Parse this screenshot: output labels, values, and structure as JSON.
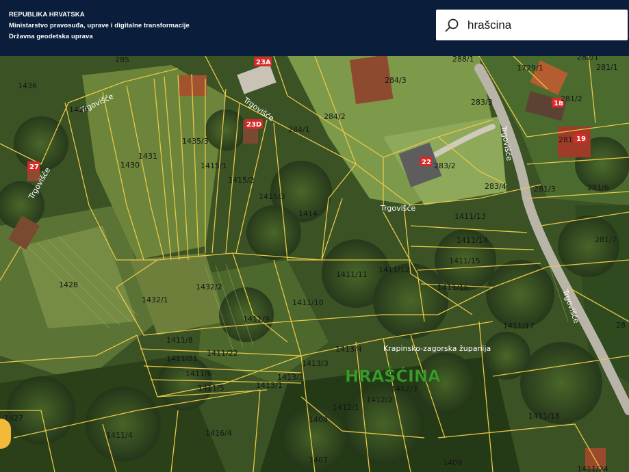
{
  "header": {
    "line1": "REPUBLIKA HRVATSKA",
    "line2": "Ministarstvo pravosuđa, uprave i digitalne transformacije",
    "line3": "Državna geodetska uprava"
  },
  "search": {
    "value": "hrašcina",
    "icon": "search-icon"
  },
  "map": {
    "place_name": "HRAŠĆINA",
    "county_label": "Krapinsko-zagorska županija",
    "roads": {
      "trgoviste_nw": "Trgovišće",
      "trgoviste_top": "Trgovišće",
      "trgoviste_mid": "Trgovišće",
      "trgoviste_right": "Trgovišće",
      "trgoviste_right2": "Trgovišće",
      "trgoviste_left": "Trgovišće"
    },
    "house_numbers": {
      "h23a": "23A",
      "h23d": "23D",
      "h22": "22",
      "h18": "18",
      "h19": "19",
      "h27": "27"
    },
    "parcels": {
      "p1436": "1436",
      "p285": "285",
      "p1429": "1429",
      "p1431": "1431",
      "p1430": "1430",
      "p1435_3": "1435/3",
      "p1415_1": "1415/1",
      "p1415_2": "1415/2",
      "p1415_3": "1415/3",
      "p1414": "1414",
      "p284_1": "284/1",
      "p284_2": "284/2",
      "p284_3": "284/3",
      "p288_1": "288/1",
      "p1729_1": "1729/1",
      "p282_1": "282/1",
      "p281_1": "281/1",
      "p281_2": "281/2",
      "p283_3": "283/3",
      "p281": "281",
      "p283_2": "283/2",
      "p283_4": "283/4",
      "p281_3": "281/3",
      "p281_6": "281/6",
      "p281_7": "281/7",
      "p1411_13": "1411/13",
      "p1411_14": "1411/14",
      "p1411_15": "1411/15",
      "p1411_16": "1411/16",
      "p1411_11": "1411/11",
      "p1411_12": "1411/12",
      "p1428": "1428",
      "p1432_2": "1432/2",
      "p1432_1": "1432/1",
      "p1411_10": "1411/10",
      "p1411_9": "1411/9",
      "p1411_17": "1411/17",
      "p1411_8": "1411/8",
      "p1411_21": "1411/21",
      "p1411_22": "1411/22",
      "p1413_4": "1413/4",
      "p1413_3": "1413/3",
      "p1411_6": "1411/6",
      "p1413_2": "1413/2",
      "p1411_5": "1411/5",
      "p1413_1": "1413/1",
      "p1412_3": "1412/3",
      "p1412_2": "1412/2",
      "p1412_1": "1412/1",
      "p1427": "1427",
      "p1408": "1408",
      "p1411_18": "1411/18",
      "p1411_4": "1411/4",
      "p1416_4": "1416/4",
      "p1407": "1407",
      "p1409": "1409",
      "p1411_24": "1411/24",
      "p28": "28"
    },
    "colors": {
      "boundary": "#e8c84a",
      "road": "#b9b4a8",
      "house_badge": "#d62a2a"
    }
  }
}
